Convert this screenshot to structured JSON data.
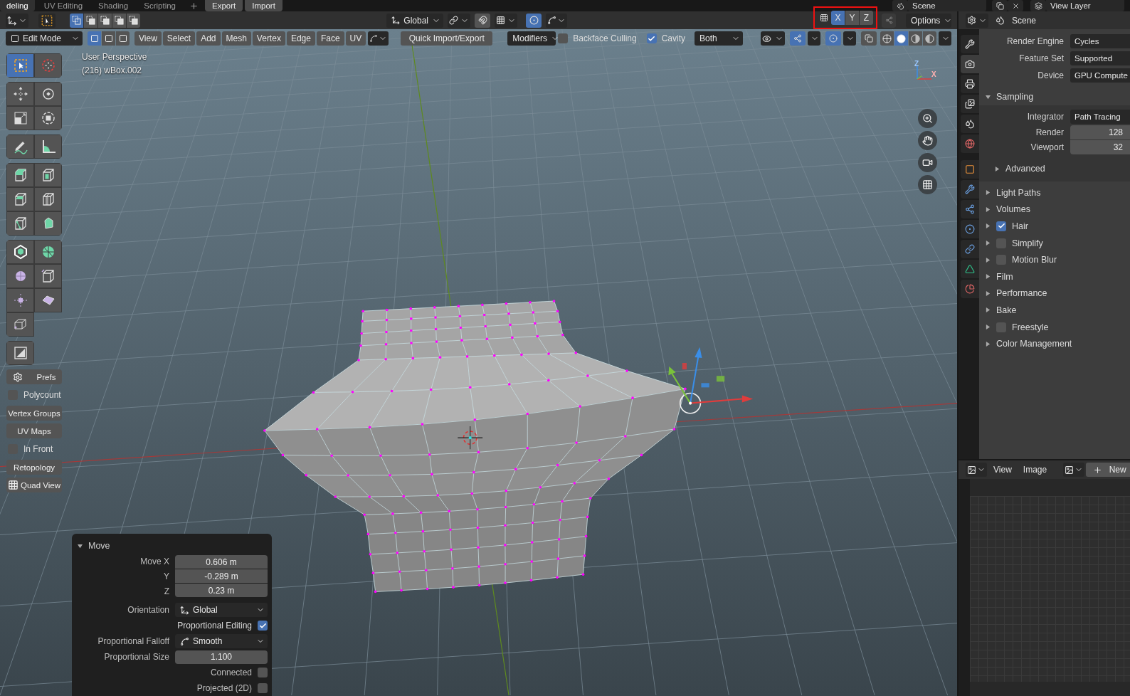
{
  "workspace_tabs": [
    {
      "label": "deling",
      "selected": true
    },
    {
      "label": "UV Editing",
      "selected": false
    },
    {
      "label": "Shading",
      "selected": false
    },
    {
      "label": "Scripting",
      "selected": false
    }
  ],
  "addon_buttons": [
    "Export",
    "Import"
  ],
  "scene_field": "Scene",
  "view_layer_field": "View Layer",
  "viewport": {
    "header": {
      "select_combine_modes": [
        {
          "selected": true
        },
        {
          "selected": false
        },
        {
          "selected": false
        },
        {
          "selected": false
        },
        {
          "selected": false
        }
      ],
      "orientation": "Global",
      "axes": [
        {
          "label": "X",
          "selected": true
        },
        {
          "label": "Y",
          "selected": false
        },
        {
          "label": "Z",
          "selected": false
        }
      ],
      "options": "Options",
      "mode": "Edit Mode",
      "select_modes": [
        {
          "selected": true
        },
        {
          "selected": false
        },
        {
          "selected": false
        }
      ],
      "menus": [
        "View",
        "Select",
        "Add",
        "Mesh",
        "Vertex",
        "Edge",
        "Face",
        "UV"
      ],
      "quick_button": "Quick Import/Export",
      "modifiers": "Modifiers",
      "backface_culling": {
        "label": "Backface Culling",
        "checked": false
      },
      "cavity": {
        "label": "Cavity",
        "checked": true
      },
      "cavity_type": "Both",
      "shading_modes": [
        {
          "selected": false
        },
        {
          "selected": true
        },
        {
          "selected": false
        },
        {
          "selected": false
        }
      ]
    },
    "overlay_text": [
      "User Perspective",
      "(216) wBox.002"
    ],
    "toolbar": {
      "groups": [
        [
          {
            "kind": "select",
            "selected": true
          },
          {
            "kind": "cursor",
            "selected": false
          }
        ],
        [
          {
            "kind": "move",
            "selected": false
          },
          {
            "kind": "rotate",
            "selected": false
          },
          {
            "kind": "scale",
            "selected": false
          },
          {
            "kind": "transform",
            "selected": false
          }
        ],
        [
          {
            "kind": "annotate",
            "selected": false
          },
          {
            "kind": "measure",
            "selected": false
          }
        ],
        [
          {
            "kind": "extrude",
            "selected": false
          },
          {
            "kind": "inset",
            "selected": false
          },
          {
            "kind": "bevel",
            "selected": false
          },
          {
            "kind": "loopcut",
            "selected": false
          },
          {
            "kind": "knife",
            "selected": false
          },
          {
            "kind": "polybuild",
            "selected": false
          }
        ],
        [
          {
            "kind": "spin",
            "selected": false
          },
          {
            "kind": "wheel",
            "selected": false
          },
          {
            "kind": "smooth",
            "selected": false
          },
          {
            "kind": "slide",
            "selected": false
          },
          {
            "kind": "shrink",
            "selected": false
          },
          {
            "kind": "shear",
            "selected": false
          },
          {
            "kind": "rip",
            "selected": false
          }
        ],
        [
          {
            "kind": "region",
            "selected": false
          }
        ]
      ],
      "items": [
        {
          "kind": "settings_button",
          "label": "Prefs"
        },
        {
          "kind": "check",
          "label": "Polycount",
          "checked": false
        },
        {
          "kind": "button",
          "label": "Vertex Groups"
        },
        {
          "kind": "button",
          "label": "UV Maps"
        },
        {
          "kind": "check",
          "label": "In Front",
          "checked": false
        },
        {
          "kind": "button",
          "label": "Retopology"
        },
        {
          "kind": "grid_button",
          "label": "Quad View"
        }
      ]
    },
    "axis_gizmo_labels": [
      "Z",
      "X"
    ],
    "move_panel": {
      "title": "Move",
      "expanded": true,
      "move": [
        {
          "label": "Move X",
          "value": "0.606 m"
        },
        {
          "label": "Y",
          "value": "-0.289 m"
        },
        {
          "label": "Z",
          "value": "0.23 m"
        }
      ],
      "orientation": {
        "label": "Orientation",
        "value": "Global"
      },
      "proportional_editing": {
        "label": "Proportional Editing",
        "checked": true
      },
      "falloff": {
        "label": "Proportional Falloff",
        "value": "Smooth"
      },
      "size": {
        "label": "Proportional Size",
        "value": "1.100"
      },
      "connected": {
        "label": "Connected",
        "checked": false
      },
      "projected": {
        "label": "Projected (2D)",
        "checked": false
      }
    }
  },
  "properties": {
    "context": "Scene",
    "tabs": [
      {
        "kind": "tool",
        "selected": false
      },
      {
        "kind": "render",
        "selected": true
      },
      {
        "kind": "output",
        "selected": false
      },
      {
        "kind": "view_layer",
        "selected": false
      },
      {
        "kind": "scene",
        "selected": false
      },
      {
        "kind": "world",
        "selected": false
      },
      {
        "kind": "object",
        "selected": false
      },
      {
        "kind": "modifiers",
        "selected": false
      },
      {
        "kind": "particles",
        "selected": false
      },
      {
        "kind": "physics",
        "selected": false
      },
      {
        "kind": "constraints",
        "selected": false
      },
      {
        "kind": "data",
        "selected": false
      },
      {
        "kind": "material",
        "selected": false
      }
    ],
    "rows": [
      {
        "label": "Render Engine",
        "value": "Cycles"
      },
      {
        "label": "Feature Set",
        "value": "Supported"
      },
      {
        "label": "Device",
        "value": "GPU Compute"
      }
    ],
    "sampling": {
      "label": "Sampling",
      "expanded": true,
      "integrator": {
        "label": "Integrator",
        "value": "Path Tracing"
      },
      "samples": [
        {
          "label": "Render",
          "value": "128"
        },
        {
          "label": "Viewport",
          "value": "32"
        }
      ],
      "advanced": {
        "label": "Advanced",
        "expanded": false
      }
    },
    "panels": [
      {
        "label": "Light Paths",
        "expanded": false
      },
      {
        "label": "Volumes",
        "expanded": false
      },
      {
        "label": "Hair",
        "expanded": false,
        "checked": true
      },
      {
        "label": "Simplify",
        "expanded": false,
        "checked": false
      },
      {
        "label": "Motion Blur",
        "expanded": false,
        "checked": false
      },
      {
        "label": "Film",
        "expanded": false
      },
      {
        "label": "Performance",
        "expanded": false
      },
      {
        "label": "Bake",
        "expanded": false
      },
      {
        "label": "Freestyle",
        "expanded": false,
        "checked": false
      },
      {
        "label": "Color Management",
        "expanded": false
      }
    ]
  },
  "image_editor": {
    "menus": [
      "View",
      "Image"
    ],
    "new_button": "New"
  }
}
